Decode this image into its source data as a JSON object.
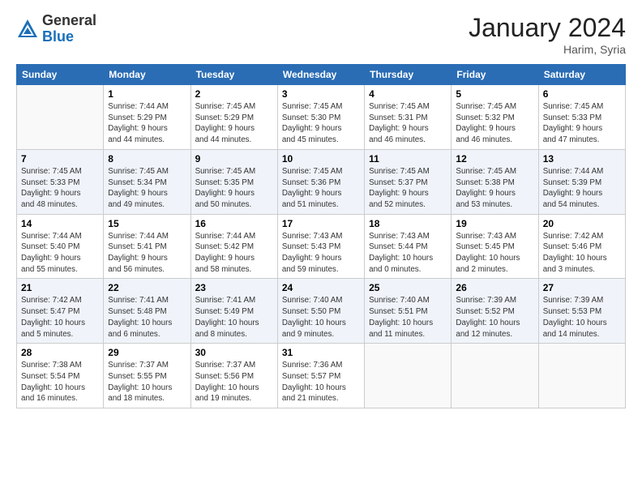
{
  "header": {
    "logo_general": "General",
    "logo_blue": "Blue",
    "title": "January 2024",
    "location": "Harim, Syria"
  },
  "weekdays": [
    "Sunday",
    "Monday",
    "Tuesday",
    "Wednesday",
    "Thursday",
    "Friday",
    "Saturday"
  ],
  "weeks": [
    [
      {
        "day": "",
        "info": ""
      },
      {
        "day": "1",
        "info": "Sunrise: 7:44 AM\nSunset: 5:29 PM\nDaylight: 9 hours\nand 44 minutes."
      },
      {
        "day": "2",
        "info": "Sunrise: 7:45 AM\nSunset: 5:29 PM\nDaylight: 9 hours\nand 44 minutes."
      },
      {
        "day": "3",
        "info": "Sunrise: 7:45 AM\nSunset: 5:30 PM\nDaylight: 9 hours\nand 45 minutes."
      },
      {
        "day": "4",
        "info": "Sunrise: 7:45 AM\nSunset: 5:31 PM\nDaylight: 9 hours\nand 46 minutes."
      },
      {
        "day": "5",
        "info": "Sunrise: 7:45 AM\nSunset: 5:32 PM\nDaylight: 9 hours\nand 46 minutes."
      },
      {
        "day": "6",
        "info": "Sunrise: 7:45 AM\nSunset: 5:33 PM\nDaylight: 9 hours\nand 47 minutes."
      }
    ],
    [
      {
        "day": "7",
        "info": "Sunrise: 7:45 AM\nSunset: 5:33 PM\nDaylight: 9 hours\nand 48 minutes."
      },
      {
        "day": "8",
        "info": "Sunrise: 7:45 AM\nSunset: 5:34 PM\nDaylight: 9 hours\nand 49 minutes."
      },
      {
        "day": "9",
        "info": "Sunrise: 7:45 AM\nSunset: 5:35 PM\nDaylight: 9 hours\nand 50 minutes."
      },
      {
        "day": "10",
        "info": "Sunrise: 7:45 AM\nSunset: 5:36 PM\nDaylight: 9 hours\nand 51 minutes."
      },
      {
        "day": "11",
        "info": "Sunrise: 7:45 AM\nSunset: 5:37 PM\nDaylight: 9 hours\nand 52 minutes."
      },
      {
        "day": "12",
        "info": "Sunrise: 7:45 AM\nSunset: 5:38 PM\nDaylight: 9 hours\nand 53 minutes."
      },
      {
        "day": "13",
        "info": "Sunrise: 7:44 AM\nSunset: 5:39 PM\nDaylight: 9 hours\nand 54 minutes."
      }
    ],
    [
      {
        "day": "14",
        "info": "Sunrise: 7:44 AM\nSunset: 5:40 PM\nDaylight: 9 hours\nand 55 minutes."
      },
      {
        "day": "15",
        "info": "Sunrise: 7:44 AM\nSunset: 5:41 PM\nDaylight: 9 hours\nand 56 minutes."
      },
      {
        "day": "16",
        "info": "Sunrise: 7:44 AM\nSunset: 5:42 PM\nDaylight: 9 hours\nand 58 minutes."
      },
      {
        "day": "17",
        "info": "Sunrise: 7:43 AM\nSunset: 5:43 PM\nDaylight: 9 hours\nand 59 minutes."
      },
      {
        "day": "18",
        "info": "Sunrise: 7:43 AM\nSunset: 5:44 PM\nDaylight: 10 hours\nand 0 minutes."
      },
      {
        "day": "19",
        "info": "Sunrise: 7:43 AM\nSunset: 5:45 PM\nDaylight: 10 hours\nand 2 minutes."
      },
      {
        "day": "20",
        "info": "Sunrise: 7:42 AM\nSunset: 5:46 PM\nDaylight: 10 hours\nand 3 minutes."
      }
    ],
    [
      {
        "day": "21",
        "info": "Sunrise: 7:42 AM\nSunset: 5:47 PM\nDaylight: 10 hours\nand 5 minutes."
      },
      {
        "day": "22",
        "info": "Sunrise: 7:41 AM\nSunset: 5:48 PM\nDaylight: 10 hours\nand 6 minutes."
      },
      {
        "day": "23",
        "info": "Sunrise: 7:41 AM\nSunset: 5:49 PM\nDaylight: 10 hours\nand 8 minutes."
      },
      {
        "day": "24",
        "info": "Sunrise: 7:40 AM\nSunset: 5:50 PM\nDaylight: 10 hours\nand 9 minutes."
      },
      {
        "day": "25",
        "info": "Sunrise: 7:40 AM\nSunset: 5:51 PM\nDaylight: 10 hours\nand 11 minutes."
      },
      {
        "day": "26",
        "info": "Sunrise: 7:39 AM\nSunset: 5:52 PM\nDaylight: 10 hours\nand 12 minutes."
      },
      {
        "day": "27",
        "info": "Sunrise: 7:39 AM\nSunset: 5:53 PM\nDaylight: 10 hours\nand 14 minutes."
      }
    ],
    [
      {
        "day": "28",
        "info": "Sunrise: 7:38 AM\nSunset: 5:54 PM\nDaylight: 10 hours\nand 16 minutes."
      },
      {
        "day": "29",
        "info": "Sunrise: 7:37 AM\nSunset: 5:55 PM\nDaylight: 10 hours\nand 18 minutes."
      },
      {
        "day": "30",
        "info": "Sunrise: 7:37 AM\nSunset: 5:56 PM\nDaylight: 10 hours\nand 19 minutes."
      },
      {
        "day": "31",
        "info": "Sunrise: 7:36 AM\nSunset: 5:57 PM\nDaylight: 10 hours\nand 21 minutes."
      },
      {
        "day": "",
        "info": ""
      },
      {
        "day": "",
        "info": ""
      },
      {
        "day": "",
        "info": ""
      }
    ]
  ]
}
